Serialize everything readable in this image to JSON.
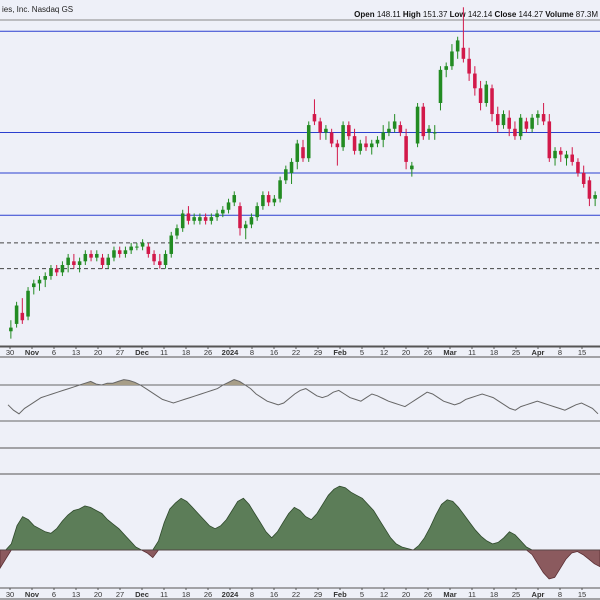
{
  "header": {
    "company_fragment": "ies, Inc. Nasdaq GS",
    "ohlc": [
      {
        "label": "Open",
        "value": "148.11"
      },
      {
        "label": "High",
        "value": "151.37"
      },
      {
        "label": "Low",
        "value": "142.14"
      },
      {
        "label": "Close",
        "value": "144.27"
      },
      {
        "label": "Volume",
        "value": "87.3M"
      }
    ]
  },
  "colors": {
    "background": "#eef0f8",
    "up_candle": "#228b22",
    "down_candle": "#d2194a",
    "resistance_line": "#2b3fcf",
    "dashed_line": "#444444",
    "rsi_line": "#666666",
    "rsi_fill": "#a79e88",
    "macd_pos_fill": "#5c7d58",
    "macd_neg_fill": "#8b5a5e",
    "axis_text": "#333333"
  },
  "chart_data": [
    {
      "type": "candlestick",
      "panel": "price",
      "x_tick_labels": [
        "30",
        "Nov",
        "6",
        "13",
        "20",
        "27",
        "Dec",
        "11",
        "18",
        "26",
        "2024",
        "8",
        "16",
        "22",
        "29",
        "Feb",
        "5",
        "12",
        "20",
        "26",
        "Mar",
        "11",
        "18",
        "25",
        "Apr",
        "8",
        "15"
      ],
      "ylim": [
        70,
        158
      ],
      "horizontal_lines": [
        155.5,
        128.0,
        117.0,
        105.5
      ],
      "dashed_lines": [
        98.0,
        91.0
      ],
      "candles": [
        {
          "o": 74,
          "h": 77,
          "l": 72,
          "c": 75
        },
        {
          "o": 76,
          "h": 82,
          "l": 75,
          "c": 81
        },
        {
          "o": 79,
          "h": 83,
          "l": 76,
          "c": 77
        },
        {
          "o": 78,
          "h": 86,
          "l": 77,
          "c": 85
        },
        {
          "o": 86,
          "h": 88,
          "l": 84,
          "c": 87
        },
        {
          "o": 87,
          "h": 89,
          "l": 85,
          "c": 88
        },
        {
          "o": 88,
          "h": 90,
          "l": 86,
          "c": 89
        },
        {
          "o": 89,
          "h": 92,
          "l": 88,
          "c": 91
        },
        {
          "o": 91,
          "h": 92,
          "l": 89,
          "c": 90
        },
        {
          "o": 90,
          "h": 93,
          "l": 89,
          "c": 92
        },
        {
          "o": 92,
          "h": 95,
          "l": 90,
          "c": 94
        },
        {
          "o": 93,
          "h": 95,
          "l": 91,
          "c": 92
        },
        {
          "o": 92,
          "h": 94,
          "l": 90,
          "c": 93
        },
        {
          "o": 93,
          "h": 96,
          "l": 92,
          "c": 95
        },
        {
          "o": 95,
          "h": 96,
          "l": 93,
          "c": 94
        },
        {
          "o": 94,
          "h": 96,
          "l": 93,
          "c": 95
        },
        {
          "o": 94,
          "h": 95,
          "l": 91,
          "c": 92
        },
        {
          "o": 92,
          "h": 95,
          "l": 91,
          "c": 94
        },
        {
          "o": 94,
          "h": 97,
          "l": 93,
          "c": 96
        },
        {
          "o": 96,
          "h": 97,
          "l": 94,
          "c": 95
        },
        {
          "o": 95,
          "h": 97,
          "l": 94,
          "c": 96
        },
        {
          "o": 96,
          "h": 98,
          "l": 95,
          "c": 97
        },
        {
          "o": 97,
          "h": 98,
          "l": 96,
          "c": 97
        },
        {
          "o": 97,
          "h": 99,
          "l": 96,
          "c": 98
        },
        {
          "o": 97,
          "h": 98,
          "l": 94,
          "c": 95
        },
        {
          "o": 95,
          "h": 96,
          "l": 92,
          "c": 93
        },
        {
          "o": 93,
          "h": 95,
          "l": 91,
          "c": 92
        },
        {
          "o": 92,
          "h": 96,
          "l": 91,
          "c": 95
        },
        {
          "o": 95,
          "h": 101,
          "l": 94,
          "c": 100
        },
        {
          "o": 100,
          "h": 103,
          "l": 99,
          "c": 102
        },
        {
          "o": 102,
          "h": 107,
          "l": 101,
          "c": 106
        },
        {
          "o": 106,
          "h": 108,
          "l": 103,
          "c": 104
        },
        {
          "o": 104,
          "h": 106,
          "l": 103,
          "c": 105
        },
        {
          "o": 104,
          "h": 106,
          "l": 103,
          "c": 105
        },
        {
          "o": 105,
          "h": 106,
          "l": 103,
          "c": 104
        },
        {
          "o": 104,
          "h": 106,
          "l": 103,
          "c": 105
        },
        {
          "o": 105,
          "h": 107,
          "l": 104,
          "c": 106
        },
        {
          "o": 106,
          "h": 108,
          "l": 105,
          "c": 107
        },
        {
          "o": 107,
          "h": 110,
          "l": 106,
          "c": 109
        },
        {
          "o": 109,
          "h": 112,
          "l": 108,
          "c": 111
        },
        {
          "o": 108,
          "h": 109,
          "l": 100,
          "c": 102
        },
        {
          "o": 102,
          "h": 104,
          "l": 99,
          "c": 103
        },
        {
          "o": 103,
          "h": 106,
          "l": 102,
          "c": 105
        },
        {
          "o": 105,
          "h": 109,
          "l": 104,
          "c": 108
        },
        {
          "o": 108,
          "h": 112,
          "l": 107,
          "c": 111
        },
        {
          "o": 111,
          "h": 112,
          "l": 108,
          "c": 109
        },
        {
          "o": 109,
          "h": 111,
          "l": 108,
          "c": 110
        },
        {
          "o": 110,
          "h": 116,
          "l": 109,
          "c": 115
        },
        {
          "o": 115,
          "h": 119,
          "l": 114,
          "c": 118
        },
        {
          "o": 117,
          "h": 121,
          "l": 114,
          "c": 120
        },
        {
          "o": 120,
          "h": 126,
          "l": 118,
          "c": 125
        },
        {
          "o": 124,
          "h": 126,
          "l": 120,
          "c": 121
        },
        {
          "o": 121,
          "h": 131,
          "l": 120,
          "c": 130
        },
        {
          "o": 133,
          "h": 137,
          "l": 130,
          "c": 131
        },
        {
          "o": 131,
          "h": 132,
          "l": 126,
          "c": 128
        },
        {
          "o": 128,
          "h": 130,
          "l": 126,
          "c": 129
        },
        {
          "o": 128,
          "h": 129,
          "l": 124,
          "c": 125
        },
        {
          "o": 125,
          "h": 126,
          "l": 119,
          "c": 124
        },
        {
          "o": 124,
          "h": 131,
          "l": 123,
          "c": 130
        },
        {
          "o": 130,
          "h": 131,
          "l": 126,
          "c": 127
        },
        {
          "o": 127,
          "h": 129,
          "l": 122,
          "c": 123
        },
        {
          "o": 123,
          "h": 126,
          "l": 122,
          "c": 125
        },
        {
          "o": 125,
          "h": 127,
          "l": 123,
          "c": 124
        },
        {
          "o": 124,
          "h": 126,
          "l": 122,
          "c": 125
        },
        {
          "o": 125,
          "h": 127,
          "l": 124,
          "c": 126
        },
        {
          "o": 126,
          "h": 130,
          "l": 124,
          "c": 128
        },
        {
          "o": 128,
          "h": 131,
          "l": 127,
          "c": 129
        },
        {
          "o": 129,
          "h": 133,
          "l": 128,
          "c": 131
        },
        {
          "o": 130,
          "h": 131,
          "l": 127,
          "c": 128
        },
        {
          "o": 127,
          "h": 129,
          "l": 118,
          "c": 120
        },
        {
          "o": 118,
          "h": 120,
          "l": 116,
          "c": 119
        },
        {
          "o": 125,
          "h": 136,
          "l": 124,
          "c": 135
        },
        {
          "o": 135,
          "h": 136,
          "l": 126,
          "c": 127
        },
        {
          "o": 128,
          "h": 130,
          "l": 126,
          "c": 129
        },
        {
          "o": 128,
          "h": 130,
          "l": 126,
          "c": 128
        },
        {
          "o": 136,
          "h": 146,
          "l": 134,
          "c": 145
        },
        {
          "o": 145,
          "h": 147,
          "l": 143,
          "c": 146
        },
        {
          "o": 146,
          "h": 152,
          "l": 145,
          "c": 150
        },
        {
          "o": 150,
          "h": 154,
          "l": 148,
          "c": 153
        },
        {
          "o": 151,
          "h": 162,
          "l": 147,
          "c": 148
        },
        {
          "o": 148,
          "h": 151,
          "l": 142,
          "c": 144
        },
        {
          "o": 144,
          "h": 146,
          "l": 138,
          "c": 140
        },
        {
          "o": 140,
          "h": 142,
          "l": 134,
          "c": 136
        },
        {
          "o": 136,
          "h": 142,
          "l": 135,
          "c": 141
        },
        {
          "o": 140,
          "h": 141,
          "l": 131,
          "c": 133
        },
        {
          "o": 133,
          "h": 135,
          "l": 128,
          "c": 130
        },
        {
          "o": 130,
          "h": 134,
          "l": 129,
          "c": 133
        },
        {
          "o": 132,
          "h": 134,
          "l": 127,
          "c": 129
        },
        {
          "o": 129,
          "h": 131,
          "l": 126,
          "c": 127
        },
        {
          "o": 127,
          "h": 133,
          "l": 126,
          "c": 132
        },
        {
          "o": 131,
          "h": 132,
          "l": 128,
          "c": 129
        },
        {
          "o": 129,
          "h": 133,
          "l": 128,
          "c": 132
        },
        {
          "o": 132,
          "h": 134,
          "l": 130,
          "c": 133
        },
        {
          "o": 133,
          "h": 136,
          "l": 130,
          "c": 131
        },
        {
          "o": 131,
          "h": 133,
          "l": 120,
          "c": 121
        },
        {
          "o": 121,
          "h": 124,
          "l": 119,
          "c": 123
        },
        {
          "o": 123,
          "h": 124,
          "l": 120,
          "c": 122
        },
        {
          "o": 121,
          "h": 123,
          "l": 119,
          "c": 122
        },
        {
          "o": 122,
          "h": 124,
          "l": 119,
          "c": 120
        },
        {
          "o": 120,
          "h": 121,
          "l": 116,
          "c": 117
        },
        {
          "o": 117,
          "h": 119,
          "l": 113,
          "c": 114
        },
        {
          "o": 115,
          "h": 116,
          "l": 108,
          "c": 110
        },
        {
          "o": 110,
          "h": 112,
          "l": 108,
          "c": 111
        }
      ]
    },
    {
      "type": "line",
      "panel": "rsi",
      "ylim": [
        0,
        100
      ],
      "reference_lines": [
        70,
        30
      ],
      "fill_above": 70,
      "values": [
        48,
        42,
        38,
        44,
        48,
        52,
        56,
        58,
        60,
        62,
        64,
        66,
        68,
        70,
        72,
        74,
        71,
        70,
        72,
        72,
        74,
        76,
        75,
        73,
        70,
        66,
        62,
        58,
        54,
        52,
        50,
        52,
        54,
        56,
        58,
        60,
        62,
        64,
        66,
        70,
        73,
        76,
        74,
        70,
        66,
        60,
        56,
        52,
        50,
        48,
        50,
        55,
        60,
        64,
        66,
        62,
        58,
        56,
        58,
        62,
        64,
        60,
        56,
        54,
        52,
        56,
        60,
        58,
        55,
        52,
        50,
        48,
        46,
        50,
        54,
        58,
        62,
        60,
        56,
        52,
        50,
        48,
        50,
        54,
        56,
        58,
        60,
        58,
        56,
        52,
        48,
        44,
        42,
        46,
        48,
        50,
        52,
        50,
        48,
        46,
        44,
        42,
        45,
        48,
        50,
        47,
        44,
        38
      ],
      "ref_top_line": 70,
      "ref_bottom_line": 30
    },
    {
      "type": "area",
      "panel": "macd",
      "ylim": [
        -2.5,
        5
      ],
      "zero_line": 0,
      "values": [
        -1.2,
        -0.6,
        0.4,
        1.6,
        2.2,
        2.0,
        1.6,
        1.4,
        1.2,
        1.1,
        1.4,
        1.9,
        2.3,
        2.6,
        2.7,
        2.9,
        2.8,
        2.6,
        2.4,
        2.0,
        1.7,
        1.4,
        1.0,
        0.6,
        0.2,
        0.0,
        -0.2,
        -0.5,
        0.6,
        1.8,
        2.7,
        3.1,
        3.4,
        3.2,
        2.8,
        2.4,
        2.0,
        1.6,
        1.4,
        1.6,
        2.0,
        2.6,
        3.2,
        3.4,
        3.0,
        2.4,
        1.8,
        1.2,
        0.8,
        1.2,
        1.8,
        2.4,
        2.8,
        2.6,
        2.2,
        2.0,
        2.4,
        3.0,
        3.6,
        4.0,
        4.2,
        4.1,
        3.8,
        3.6,
        3.4,
        3.0,
        2.6,
        2.0,
        1.4,
        0.8,
        0.4,
        0.2,
        0.1,
        0.0,
        0.3,
        0.8,
        1.5,
        2.3,
        3.0,
        3.3,
        3.2,
        2.8,
        2.3,
        1.8,
        1.3,
        0.9,
        0.6,
        0.4,
        0.5,
        0.8,
        1.2,
        1.0,
        0.6,
        0.2,
        -0.3,
        -0.9,
        -1.5,
        -1.9,
        -1.8,
        -1.2,
        -0.6,
        -0.2,
        -0.1,
        -0.3,
        -0.6,
        -0.9,
        -1.1
      ]
    }
  ],
  "bottom_axis_labels": [
    "30",
    "Nov",
    "6",
    "13",
    "20",
    "27",
    "Dec",
    "11",
    "18",
    "26",
    "2024",
    "8",
    "16",
    "22",
    "29",
    "Feb",
    "5",
    "12",
    "20",
    "26",
    "Mar",
    "11",
    "18",
    "25",
    "Apr",
    "8",
    "15"
  ]
}
